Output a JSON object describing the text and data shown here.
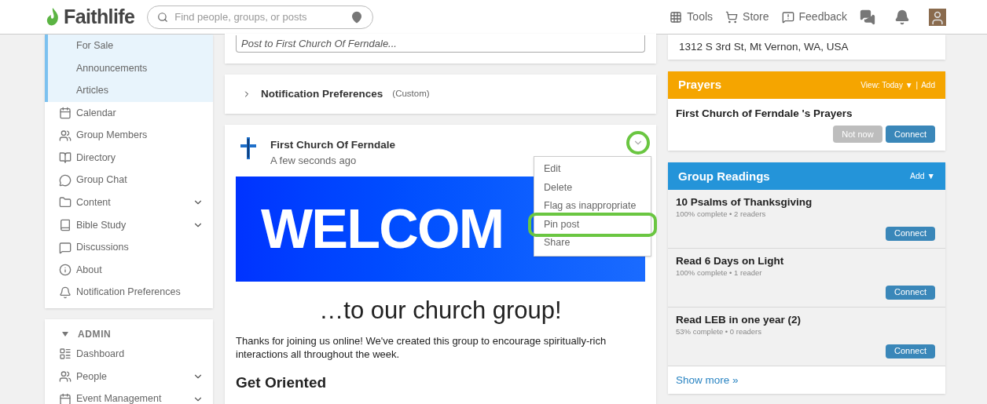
{
  "header": {
    "logo": "Faithlife",
    "search": {
      "placeholder": "Find people, groups, or posts"
    },
    "nav": [
      {
        "kind": "tools",
        "label": "Tools"
      },
      {
        "kind": "store",
        "label": "Store"
      },
      {
        "kind": "feedback",
        "label": "Feedback"
      }
    ]
  },
  "sidebar": {
    "items": [
      {
        "kind": "sub",
        "label": "For Sale",
        "expandable": false
      },
      {
        "kind": "sub",
        "label": "Announcements",
        "expandable": false
      },
      {
        "kind": "sub",
        "label": "Articles",
        "expandable": false
      },
      {
        "kind": "calendar",
        "label": "Calendar",
        "expandable": false
      },
      {
        "kind": "members",
        "label": "Group Members",
        "expandable": false
      },
      {
        "kind": "directory",
        "label": "Directory",
        "expandable": false
      },
      {
        "kind": "chat",
        "label": "Group Chat",
        "expandable": false
      },
      {
        "kind": "folder",
        "label": "Content",
        "expandable": true
      },
      {
        "kind": "bible",
        "label": "Bible Study",
        "expandable": true
      },
      {
        "kind": "discussions",
        "label": "Discussions",
        "expandable": false
      },
      {
        "kind": "info",
        "label": "About",
        "expandable": false
      },
      {
        "kind": "bell",
        "label": "Notification Preferences",
        "expandable": false
      }
    ],
    "admin": {
      "title": "ADMIN",
      "expanded": true,
      "items": [
        {
          "kind": "dashboard",
          "label": "Dashboard",
          "expandable": false
        },
        {
          "kind": "members",
          "label": "People",
          "expandable": true
        },
        {
          "kind": "calendar",
          "label": "Event Management",
          "expandable": true
        }
      ]
    }
  },
  "composer": {
    "placeholder": "Post to First Church Of Ferndale..."
  },
  "notification_preferences": {
    "title": "Notification Preferences",
    "note": "(Custom)",
    "expanded": false
  },
  "post": {
    "author": "First Church Of Ferndale",
    "time": "A few seconds ago",
    "banner_text": "WELCOM",
    "menu_open": true,
    "menu": [
      {
        "label": "Edit",
        "highlighted": false
      },
      {
        "label": "Delete",
        "highlighted": false
      },
      {
        "label": "Flag as inappropriate",
        "highlighted": false
      },
      {
        "label": "Pin post",
        "highlighted": true
      },
      {
        "label": "Share",
        "highlighted": false
      }
    ],
    "heading": "…to our church group!",
    "body": "Thanks for joining us online! We've created this group to encourage spiritually-rich interactions all throughout the week.",
    "subheading": "Get Oriented"
  },
  "location": {
    "address": "1312 S 3rd St, Mt Vernon, WA, USA"
  },
  "prayers": {
    "title": "Prayers",
    "view": "View: Today ▼",
    "separator": "|",
    "add": "Add",
    "subtitle": "First Church of Ferndale 's Prayers",
    "buttons": [
      {
        "kind": "secondary",
        "label": "Not now"
      },
      {
        "kind": "primary",
        "label": "Connect"
      }
    ]
  },
  "readings": {
    "title": "Group Readings",
    "add": "Add ▼",
    "items": [
      {
        "title": "10 Psalms of Thanksgiving",
        "meta": "100% complete • 2 readers",
        "button": "Connect"
      },
      {
        "title": "Read 6 Days on Light",
        "meta": "100% complete • 1 reader",
        "button": "Connect"
      },
      {
        "title": "Read LEB in one year (2)",
        "meta": "53% complete • 0 readers",
        "button": "Connect"
      }
    ],
    "more": "Show more »"
  }
}
